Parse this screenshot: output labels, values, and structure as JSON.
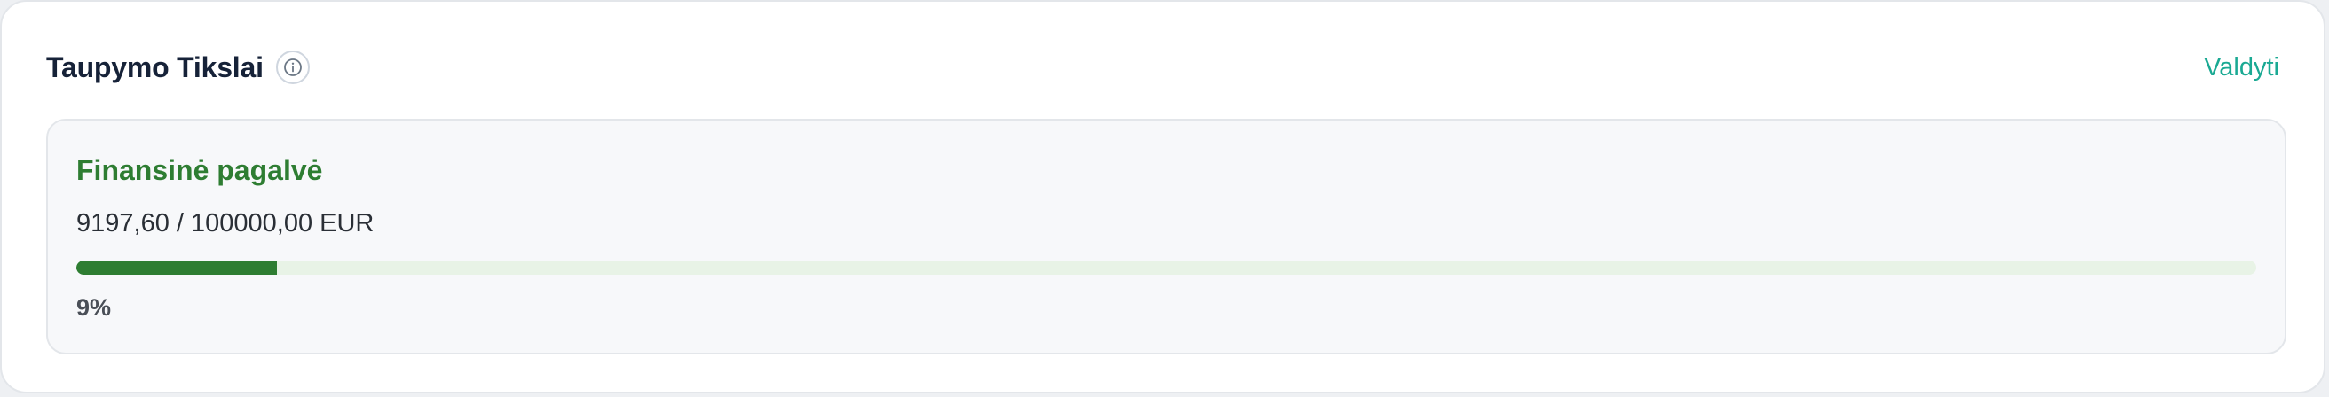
{
  "header": {
    "title": "Taupymo Tikslai",
    "info_icon": "info-icon",
    "manage_label": "Valdyti"
  },
  "goals": [
    {
      "name": "Finansinė pagalvė",
      "current": "9197,60",
      "target": "100000,00",
      "currency": "EUR",
      "amount_text": "9197,60 / 100000,00 EUR",
      "progress_fraction": 0.092,
      "percent_label": "9%"
    }
  ],
  "colors": {
    "accent": "#1aa993",
    "goal_green": "#2e7d32",
    "track_green": "#e8f3e6",
    "title": "#162238"
  }
}
